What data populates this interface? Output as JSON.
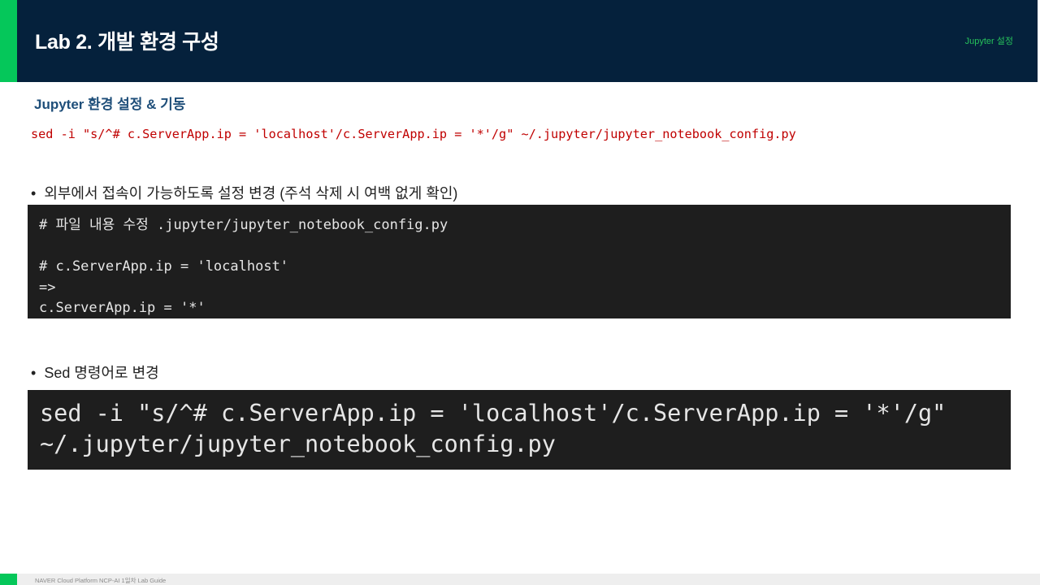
{
  "header": {
    "title": "Lab 2. 개발 환경 구성",
    "tag": "Jupyter 설정",
    "accent_color": "#05c75a",
    "background_color": "#05213c"
  },
  "section": {
    "title": "Jupyter 환경 설정 & 기동",
    "command": "sed -i \"s/^# c.ServerApp.ip = 'localhost'/c.ServerApp.ip = '*'/g\" ~/.jupyter/jupyter_notebook_config.py",
    "command_color": "#c00000"
  },
  "bullets": [
    {
      "symbol": "•",
      "text": "외부에서 접속이 가능하도록 설정 변경 (주석 삭제 시 여백 없게 확인)"
    },
    {
      "symbol": "•",
      "text": "Sed 명령어로 변경"
    }
  ],
  "code_blocks": [
    {
      "lines": [
        "# 파일 내용 수정 .jupyter/jupyter_notebook_config.py",
        "",
        "# c.ServerApp.ip = 'localhost'",
        "=>",
        "c.ServerApp.ip = '*'"
      ]
    },
    {
      "lines": [
        "sed -i \"s/^# c.ServerApp.ip = 'localhost'/c.ServerApp.ip = '*'/g\"",
        "~/.jupyter/jupyter_notebook_config.py"
      ]
    }
  ],
  "footer": {
    "text": "NAVER Cloud Platform  NCP-AI 1일차 Lab Guide"
  }
}
